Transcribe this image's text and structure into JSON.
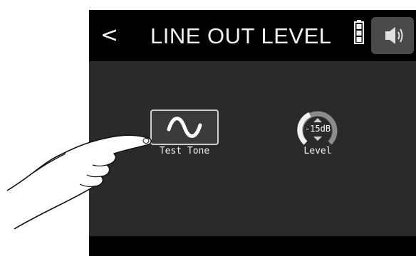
{
  "header": {
    "back_icon": "chevron-left-icon",
    "back_glyph": "<",
    "title": "LINE OUT LEVEL",
    "battery_icon": "battery-full-icon",
    "speaker_icon": "speaker-volume-icon"
  },
  "controls": {
    "test_tone": {
      "label": "Test Tone",
      "icon": "sine-wave-icon"
    },
    "level": {
      "label": "Level",
      "value": "-15dB",
      "icon": "level-knob-icon"
    }
  },
  "overlay": {
    "hand_icon": "pointing-hand-icon"
  },
  "colors": {
    "screen_bg": "#000000",
    "panel_bg": "#2a2a2a",
    "text": "#f2f2f2",
    "speaker_button_bg": "#4a4a4a",
    "knob_arc": "#9a9a9a"
  }
}
